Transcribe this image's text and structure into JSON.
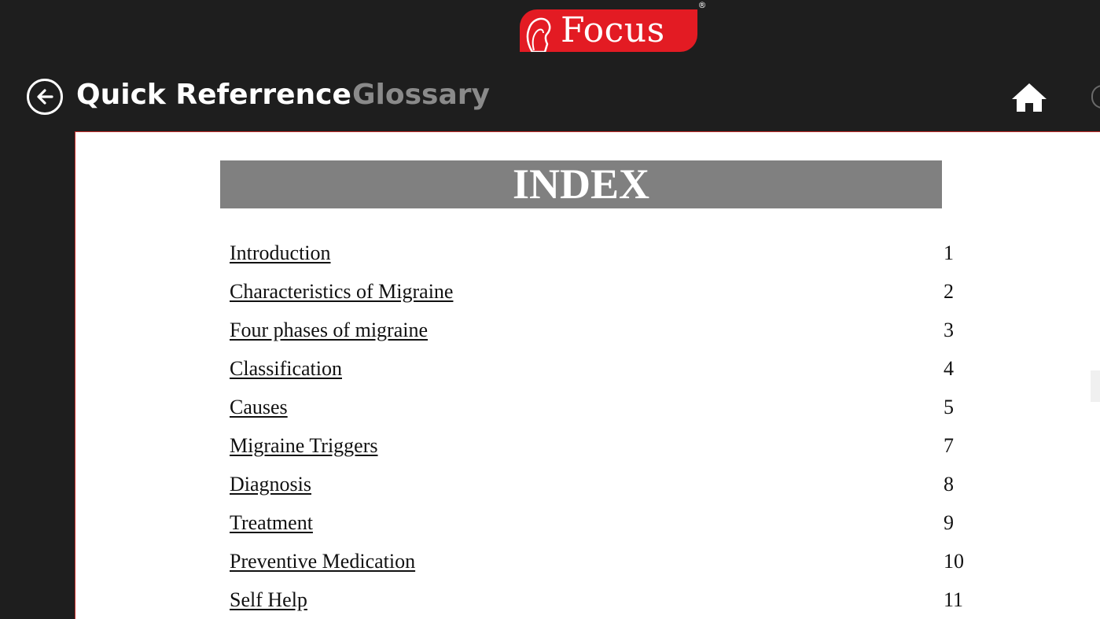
{
  "header": {
    "logo_text": "Focus",
    "logo_registered": "®",
    "title": "Quick Referrence",
    "secondary_tab": "Glossary",
    "back_icon": "back-arrow-icon",
    "home_icon": "home-icon"
  },
  "colors": {
    "background": "#1e1e1e",
    "logo_red": "#e31b23",
    "banner_gray": "#808080",
    "inactive_text": "#8a8a8a"
  },
  "index": {
    "heading": "INDEX",
    "items": [
      {
        "label": "Introduction",
        "page": "1"
      },
      {
        "label": "Characteristics of Migraine",
        "page": "2"
      },
      {
        "label": "Four phases of migraine",
        "page": "3"
      },
      {
        "label": "Classification",
        "page": "4"
      },
      {
        "label": "Causes",
        "page": "5"
      },
      {
        "label": "Migraine Triggers",
        "page": "7"
      },
      {
        "label": "Diagnosis",
        "page": "8"
      },
      {
        "label": "Treatment",
        "page": "9"
      },
      {
        "label": "Preventive Medication",
        "page": "10"
      },
      {
        "label": "Self Help",
        "page": "11"
      }
    ]
  }
}
